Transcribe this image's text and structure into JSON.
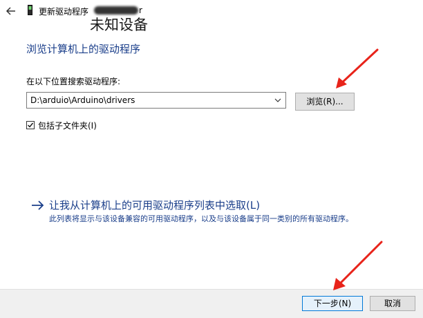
{
  "titlebar": {
    "title": "更新驱动程序",
    "title_tail": "r",
    "device_name": "未知设备"
  },
  "main": {
    "heading": "浏览计算机上的驱动程序",
    "search_label": "在以下位置搜索驱动程序:",
    "path_value": "D:\\arduio\\Arduino\\drivers",
    "browse_label": "浏览(R)...",
    "include_subfolders_label": "包括子文件夹(I)",
    "include_subfolders_checked": true,
    "pick_link": "让我从计算机上的可用驱动程序列表中选取(L)",
    "pick_desc": "此列表将显示与该设备兼容的可用驱动程序，以及与该设备属于同一类别的所有驱动程序。"
  },
  "footer": {
    "next_label": "下一步(N)",
    "cancel_label": "取消"
  },
  "colors": {
    "heading": "#1a3e8a",
    "annotation": "#e8231a",
    "primary_border": "#0078d7"
  },
  "icons": {
    "back": "arrow-left-icon",
    "app": "device-icon",
    "dropdown": "chevron-down-icon",
    "check": "checkmark-icon",
    "link": "arrow-right-icon"
  }
}
